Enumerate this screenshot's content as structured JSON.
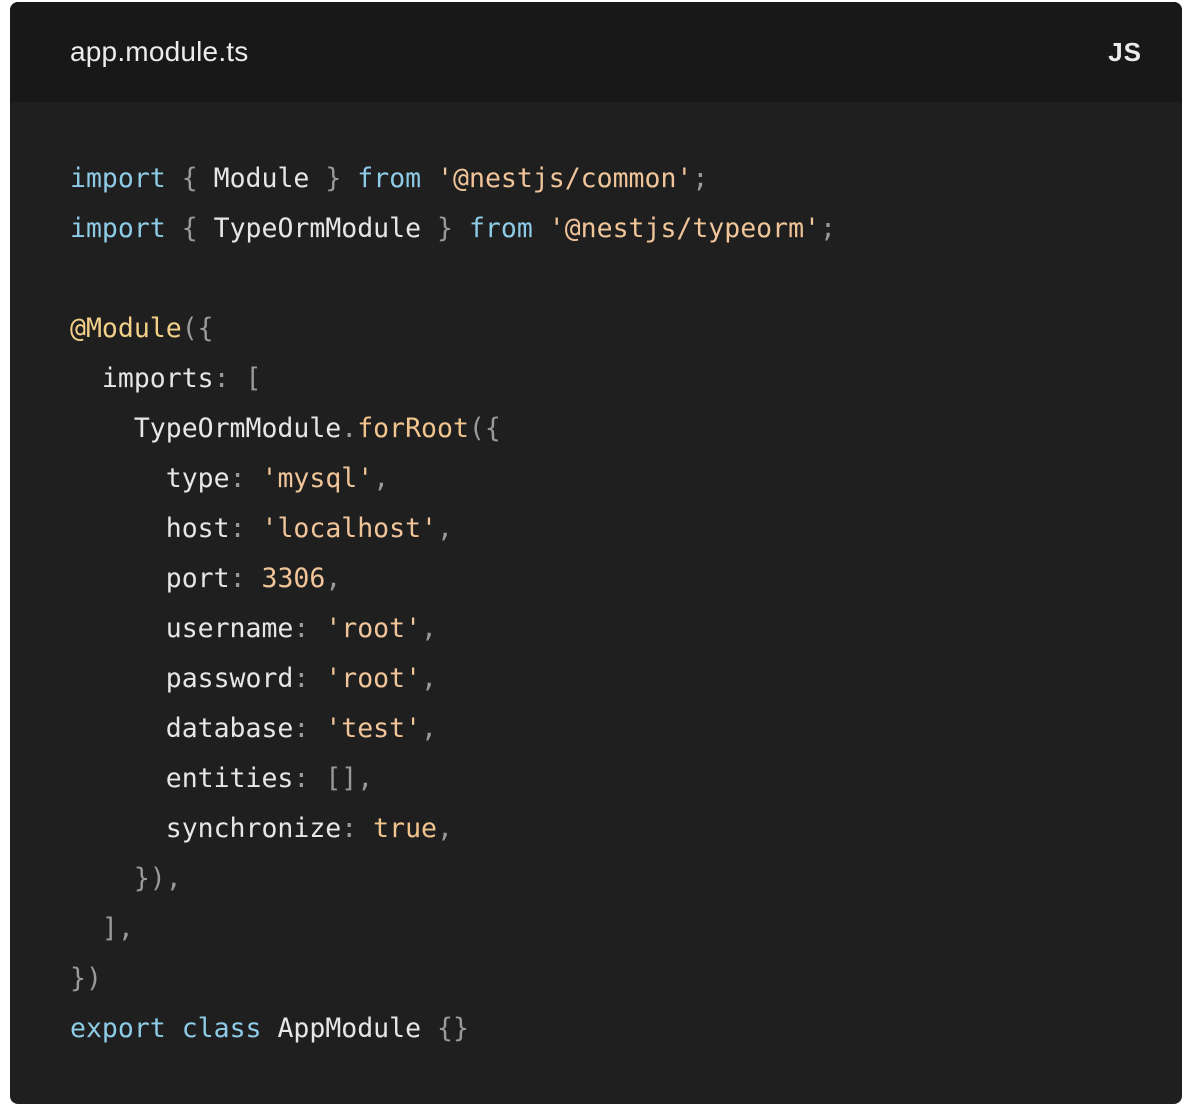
{
  "header": {
    "file_name": "app.module.ts",
    "language": "JS"
  },
  "colors": {
    "card_background": "#1f1f1f",
    "header_background": "#181818",
    "keyword": "#8ecbe6",
    "string": "#f1c59a",
    "punctuation": "#9a9a9a",
    "identifier": "#e6e6e6",
    "decorator": "#f2d08a"
  },
  "code": {
    "lines": [
      [
        [
          "keyword",
          "import"
        ],
        [
          "plain",
          " "
        ],
        [
          "punct",
          "{"
        ],
        [
          "plain",
          " "
        ],
        [
          "ident",
          "Module"
        ],
        [
          "plain",
          " "
        ],
        [
          "punct",
          "}"
        ],
        [
          "plain",
          " "
        ],
        [
          "keyword",
          "from"
        ],
        [
          "plain",
          " "
        ],
        [
          "string",
          "'@nestjs/common'"
        ],
        [
          "punct",
          ";"
        ]
      ],
      [
        [
          "keyword",
          "import"
        ],
        [
          "plain",
          " "
        ],
        [
          "punct",
          "{"
        ],
        [
          "plain",
          " "
        ],
        [
          "ident",
          "TypeOrmModule"
        ],
        [
          "plain",
          " "
        ],
        [
          "punct",
          "}"
        ],
        [
          "plain",
          " "
        ],
        [
          "keyword",
          "from"
        ],
        [
          "plain",
          " "
        ],
        [
          "string",
          "'@nestjs/typeorm'"
        ],
        [
          "punct",
          ";"
        ]
      ],
      [],
      [
        [
          "decorator",
          "@Module"
        ],
        [
          "punct",
          "({"
        ]
      ],
      [
        [
          "plain",
          "  "
        ],
        [
          "prop",
          "imports"
        ],
        [
          "punct",
          ":"
        ],
        [
          "plain",
          " "
        ],
        [
          "punct",
          "["
        ]
      ],
      [
        [
          "plain",
          "    "
        ],
        [
          "ident",
          "TypeOrmModule"
        ],
        [
          "punct",
          "."
        ],
        [
          "func",
          "forRoot"
        ],
        [
          "punct",
          "({"
        ]
      ],
      [
        [
          "plain",
          "      "
        ],
        [
          "prop",
          "type"
        ],
        [
          "punct",
          ":"
        ],
        [
          "plain",
          " "
        ],
        [
          "string",
          "'mysql'"
        ],
        [
          "punct",
          ","
        ]
      ],
      [
        [
          "plain",
          "      "
        ],
        [
          "prop",
          "host"
        ],
        [
          "punct",
          ":"
        ],
        [
          "plain",
          " "
        ],
        [
          "string",
          "'localhost'"
        ],
        [
          "punct",
          ","
        ]
      ],
      [
        [
          "plain",
          "      "
        ],
        [
          "prop",
          "port"
        ],
        [
          "punct",
          ":"
        ],
        [
          "plain",
          " "
        ],
        [
          "number",
          "3306"
        ],
        [
          "punct",
          ","
        ]
      ],
      [
        [
          "plain",
          "      "
        ],
        [
          "prop",
          "username"
        ],
        [
          "punct",
          ":"
        ],
        [
          "plain",
          " "
        ],
        [
          "string",
          "'root'"
        ],
        [
          "punct",
          ","
        ]
      ],
      [
        [
          "plain",
          "      "
        ],
        [
          "prop",
          "password"
        ],
        [
          "punct",
          ":"
        ],
        [
          "plain",
          " "
        ],
        [
          "string",
          "'root'"
        ],
        [
          "punct",
          ","
        ]
      ],
      [
        [
          "plain",
          "      "
        ],
        [
          "prop",
          "database"
        ],
        [
          "punct",
          ":"
        ],
        [
          "plain",
          " "
        ],
        [
          "string",
          "'test'"
        ],
        [
          "punct",
          ","
        ]
      ],
      [
        [
          "plain",
          "      "
        ],
        [
          "prop",
          "entities"
        ],
        [
          "punct",
          ":"
        ],
        [
          "plain",
          " "
        ],
        [
          "punct",
          "[],"
        ]
      ],
      [
        [
          "plain",
          "      "
        ],
        [
          "prop",
          "synchronize"
        ],
        [
          "punct",
          ":"
        ],
        [
          "plain",
          " "
        ],
        [
          "bool",
          "true"
        ],
        [
          "punct",
          ","
        ]
      ],
      [
        [
          "plain",
          "    "
        ],
        [
          "punct",
          "}),"
        ]
      ],
      [
        [
          "plain",
          "  "
        ],
        [
          "punct",
          "],"
        ]
      ],
      [
        [
          "punct",
          "})"
        ]
      ],
      [
        [
          "keyword",
          "export"
        ],
        [
          "plain",
          " "
        ],
        [
          "keyword",
          "class"
        ],
        [
          "plain",
          " "
        ],
        [
          "ident",
          "AppModule"
        ],
        [
          "plain",
          " "
        ],
        [
          "punct",
          "{}"
        ]
      ]
    ]
  }
}
